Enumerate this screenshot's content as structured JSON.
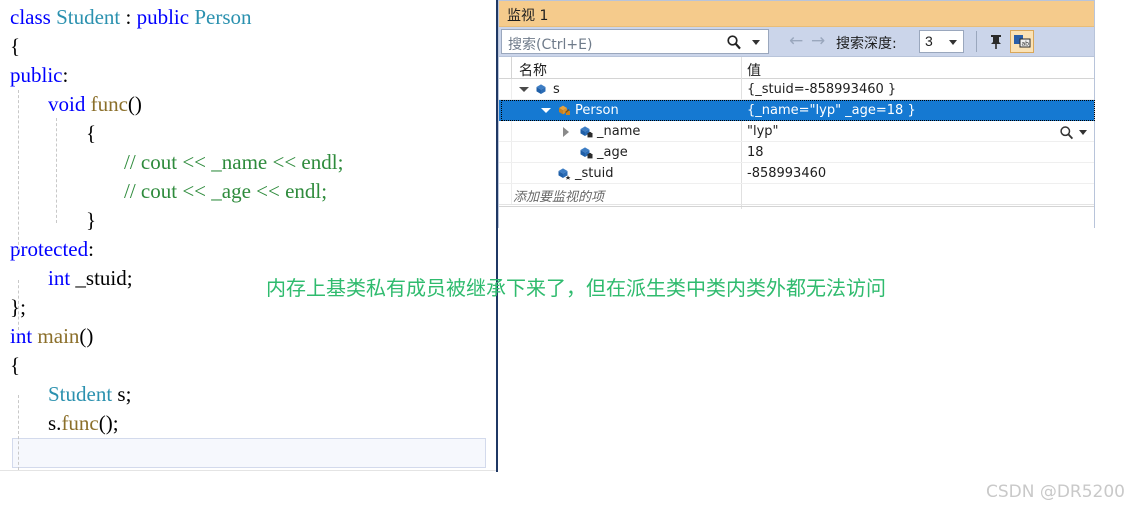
{
  "editor": {
    "lines": [
      {
        "indent": 0,
        "segments": [
          {
            "t": "class ",
            "c": "kw"
          },
          {
            "t": "Student",
            "c": "type"
          },
          {
            "t": " : ",
            "c": "punc"
          },
          {
            "t": "public ",
            "c": "kw"
          },
          {
            "t": "Person",
            "c": "type"
          }
        ]
      },
      {
        "indent": 0,
        "segments": [
          {
            "t": "{",
            "c": "punc"
          }
        ]
      },
      {
        "indent": 0,
        "segments": [
          {
            "t": "public",
            "c": "kw"
          },
          {
            "t": ":",
            "c": "punc"
          }
        ]
      },
      {
        "indent": 1,
        "segments": [
          {
            "t": "void ",
            "c": "kw"
          },
          {
            "t": "func",
            "c": "fn"
          },
          {
            "t": "()",
            "c": "punc"
          }
        ]
      },
      {
        "indent": 2,
        "segments": [
          {
            "t": "{",
            "c": "punc"
          }
        ]
      },
      {
        "indent": 3,
        "segments": [
          {
            "t": "// cout << _name << endl;",
            "c": "cmt"
          }
        ]
      },
      {
        "indent": 3,
        "segments": [
          {
            "t": "// cout << _age << endl;",
            "c": "cmt"
          }
        ]
      },
      {
        "indent": 2,
        "segments": [
          {
            "t": "}",
            "c": "punc"
          }
        ]
      },
      {
        "indent": 0,
        "segments": [
          {
            "t": "protected",
            "c": "kw"
          },
          {
            "t": ":",
            "c": "punc"
          }
        ]
      },
      {
        "indent": 1,
        "segments": [
          {
            "t": "int ",
            "c": "kw"
          },
          {
            "t": "_stuid;",
            "c": "punc"
          }
        ]
      },
      {
        "indent": 0,
        "segments": [
          {
            "t": "};",
            "c": "punc"
          }
        ]
      },
      {
        "indent": 0,
        "segments": [
          {
            "t": "int ",
            "c": "kw"
          },
          {
            "t": "main",
            "c": "fn"
          },
          {
            "t": "()",
            "c": "punc"
          }
        ]
      },
      {
        "indent": 0,
        "segments": [
          {
            "t": "{",
            "c": "punc"
          }
        ]
      },
      {
        "indent": 1,
        "segments": [
          {
            "t": "Student",
            "c": "type"
          },
          {
            "t": " s;",
            "c": "punc"
          }
        ]
      },
      {
        "indent": 1,
        "segments": [
          {
            "t": "s.",
            "c": "punc"
          },
          {
            "t": "func",
            "c": "fn"
          },
          {
            "t": "();",
            "c": "punc"
          }
        ]
      }
    ],
    "colors": {
      "keyword": "#0000ff",
      "type": "#2b91af",
      "comment": "#2e8b3c",
      "function": "#8b6f2a",
      "text": "#000000"
    }
  },
  "watch": {
    "title": "监视 1",
    "title_bar_color": "#f5cb8c",
    "search": {
      "placeholder": "搜索(Ctrl+E)",
      "icon": "search-magnifier-icon"
    },
    "toolbar": {
      "back_icon": "←",
      "forward_icon": "→",
      "depth_label": "搜索深度:",
      "depth_value": "3",
      "pin_icon": "pin-icon",
      "hex_icon": "hex-display-icon"
    },
    "columns": [
      "名称",
      "值"
    ],
    "rows": [
      {
        "indent": 0,
        "expander": "open",
        "icon": "cube-icon",
        "name": "s",
        "value": "{_stuid=-858993460 }",
        "selected": false,
        "magnifier": false
      },
      {
        "indent": 1,
        "expander": "open",
        "icon": "base-class-icon",
        "name": "Person",
        "value": "{_name=\"lyp\" _age=18 }",
        "selected": true,
        "magnifier": false
      },
      {
        "indent": 2,
        "expander": "closed",
        "icon": "cube-private-icon",
        "name": "_name",
        "value": "\"lyp\"",
        "selected": false,
        "magnifier": true
      },
      {
        "indent": 2,
        "expander": "none",
        "icon": "cube-private-icon",
        "name": "_age",
        "value": "18",
        "selected": false,
        "magnifier": false
      },
      {
        "indent": 1,
        "expander": "none",
        "icon": "cube-protected-icon",
        "name": "_stuid",
        "value": "-858993460",
        "selected": false,
        "magnifier": false
      }
    ],
    "add_watch_placeholder": "添加要监视的项",
    "selection_color": "#1579d2"
  },
  "annotation": {
    "text": "内存上基类私有成员被继承下来了，但在派生类中类内类外都无法访问",
    "color": "#2fbb6e"
  },
  "watermark": {
    "text": "CSDN @DR5200"
  }
}
